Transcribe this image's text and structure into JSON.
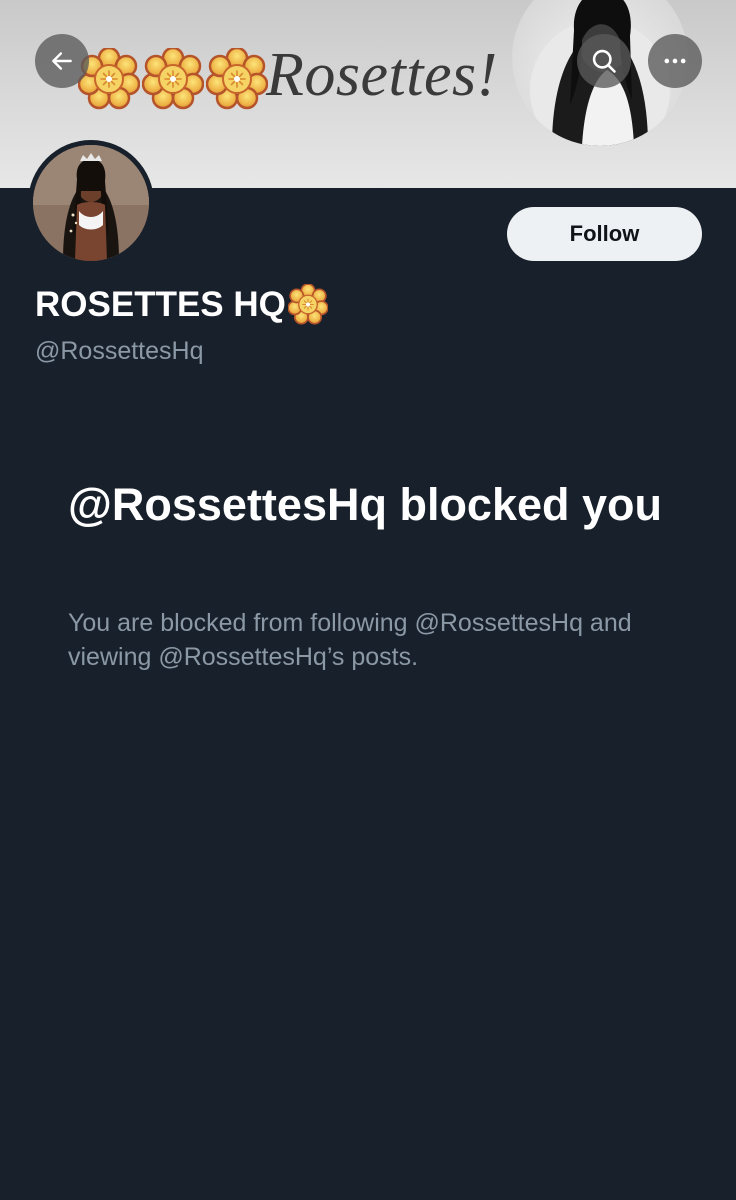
{
  "banner": {
    "title": "Rosettes!",
    "rosette_count": 3
  },
  "header": {
    "back_icon": "arrow-left-icon",
    "search_icon": "search-icon",
    "more_icon": "more-horizontal-icon"
  },
  "profile": {
    "display_name": "ROSETTES HQ",
    "name_emoji": "rosette-icon",
    "handle": "@RossettesHq",
    "follow_label": "Follow"
  },
  "blocked": {
    "title": "@RossettesHq blocked you",
    "description": "You are blocked from following @RossettesHq and viewing @RossettesHq’s posts."
  },
  "colors": {
    "background": "#18202b",
    "text_primary": "#ffffff",
    "text_secondary": "#8b98a5",
    "follow_bg": "#eef1f3",
    "rosette_petal": "#e8b14a",
    "rosette_outline": "#b5532a"
  }
}
